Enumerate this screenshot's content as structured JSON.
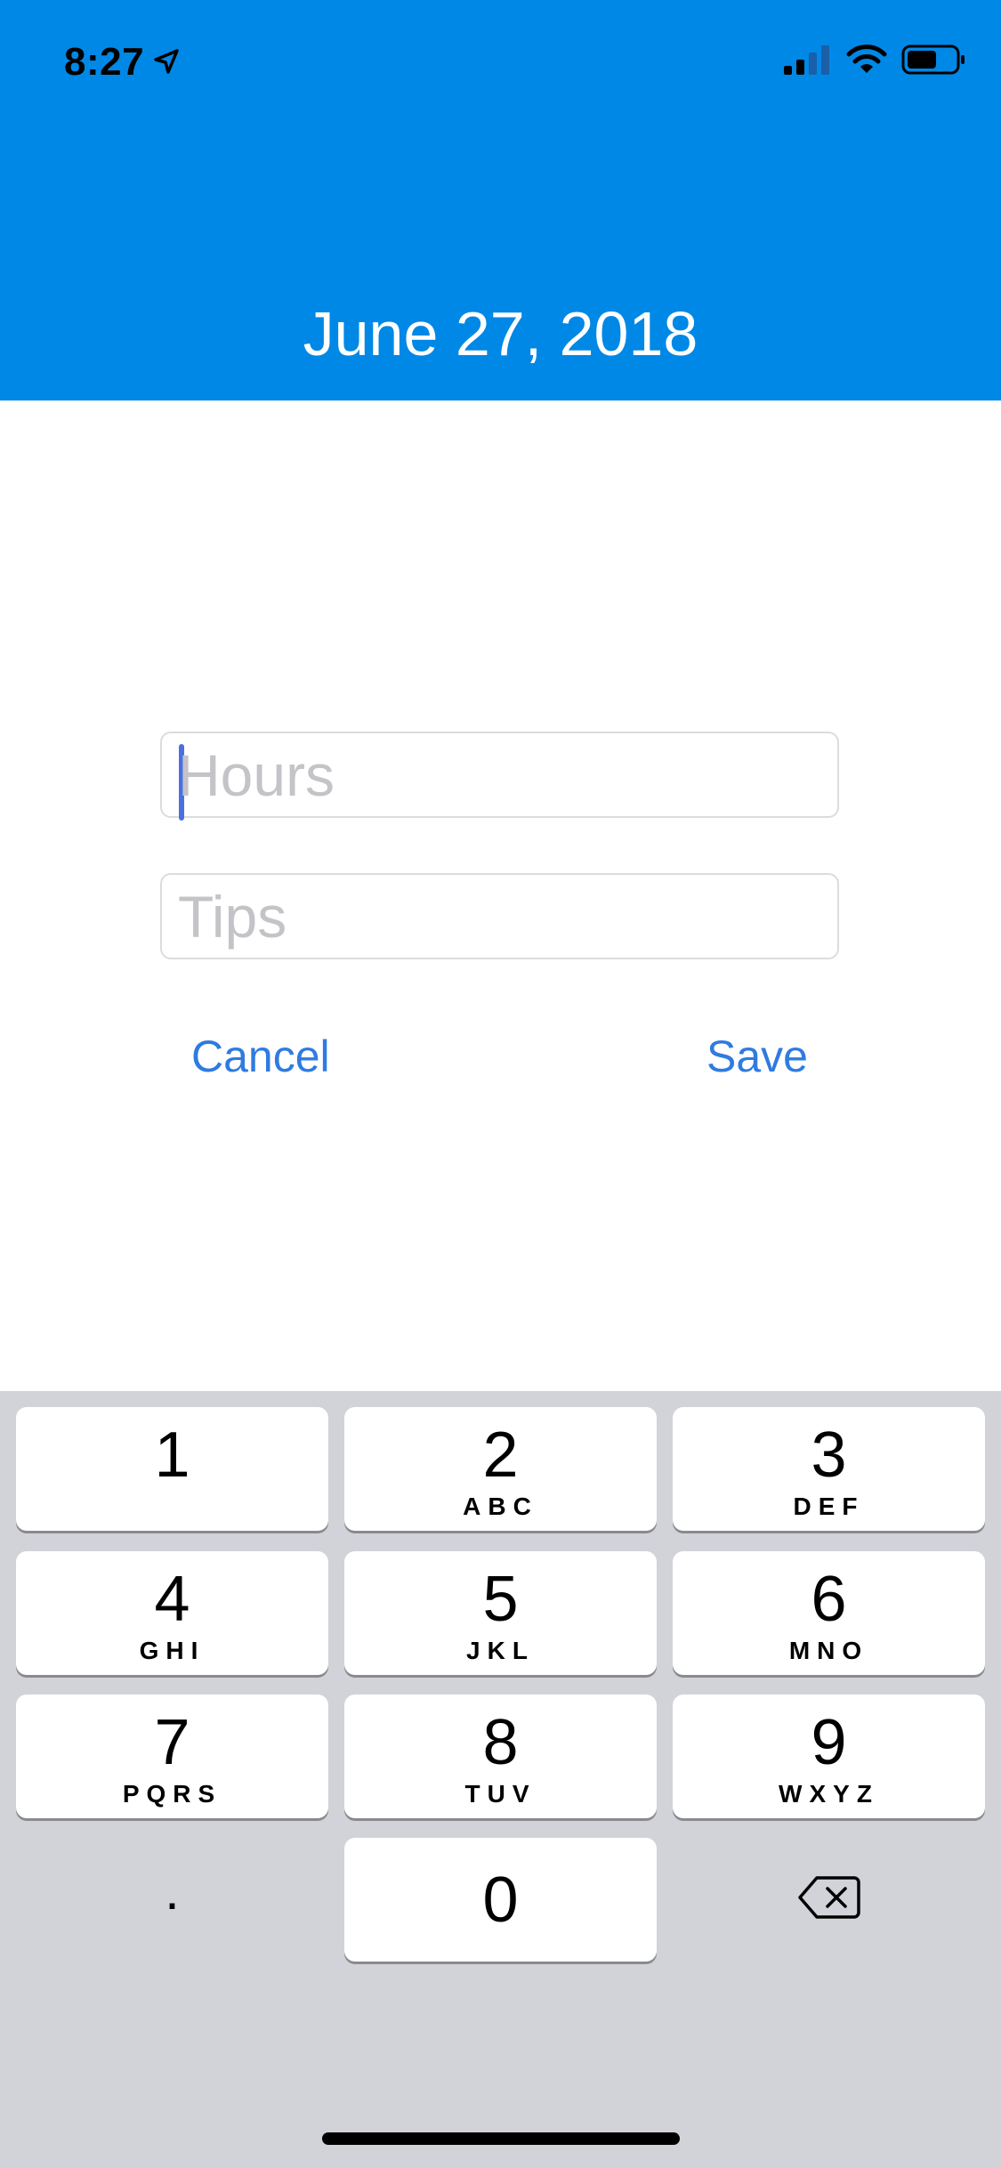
{
  "status_bar": {
    "time": "8:27",
    "icons": [
      "location-arrow-icon",
      "cellular-signal-icon",
      "wifi-icon",
      "battery-icon"
    ]
  },
  "header": {
    "title": "June 27, 2018",
    "background_color": "#0088E6"
  },
  "form": {
    "hours": {
      "placeholder": "Hours",
      "value": ""
    },
    "tips": {
      "placeholder": "Tips",
      "value": ""
    },
    "cancel_label": "Cancel",
    "save_label": "Save",
    "accent_color": "#2F7BE0"
  },
  "keypad": {
    "keys": [
      {
        "number": "1",
        "letters": ""
      },
      {
        "number": "2",
        "letters": "ABC"
      },
      {
        "number": "3",
        "letters": "DEF"
      },
      {
        "number": "4",
        "letters": "GHI"
      },
      {
        "number": "5",
        "letters": "JKL"
      },
      {
        "number": "6",
        "letters": "MNO"
      },
      {
        "number": "7",
        "letters": "PQRS"
      },
      {
        "number": "8",
        "letters": "TUV"
      },
      {
        "number": "9",
        "letters": "WXYZ"
      }
    ],
    "zero": "0",
    "decimal": ".",
    "delete_icon": "backspace-icon"
  }
}
